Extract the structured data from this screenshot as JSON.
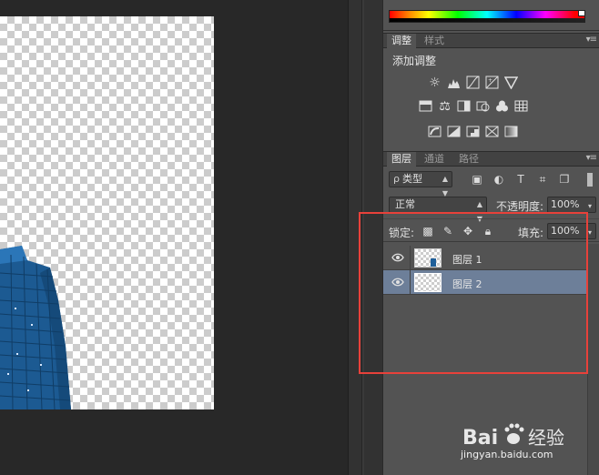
{
  "colors": {
    "accent_highlight": "#e8413a",
    "selected_layer": "#6d7f99",
    "panel_bg": "#535353",
    "canvas_bg": "#282828",
    "building": "#1f5f99"
  },
  "adjustments_panel": {
    "tabs": [
      {
        "label": "调整",
        "active": true
      },
      {
        "label": "样式",
        "active": false
      }
    ],
    "title": "添加调整",
    "icons_row1": [
      "brightness-icon",
      "levels-icon",
      "curves-icon",
      "exposure-icon",
      "vibrance-icon"
    ],
    "icons_row2": [
      "hue-saturation-icon",
      "color-balance-icon",
      "black-white-icon",
      "photo-filter-icon",
      "channel-mixer-icon",
      "color-lookup-icon"
    ],
    "icons_row3": [
      "invert-icon",
      "posterize-icon",
      "threshold-icon",
      "selective-color-icon",
      "gradient-map-icon"
    ]
  },
  "layers_panel": {
    "tabs": [
      {
        "label": "图层",
        "active": true
      },
      {
        "label": "通道",
        "active": false
      },
      {
        "label": "路径",
        "active": false
      }
    ],
    "kind_filter": "类型",
    "kind_filter_lead": "ρ",
    "blend_mode": "正常",
    "opacity_label": "不透明度:",
    "opacity_value": "100%",
    "lock_label": "锁定:",
    "fill_label": "填充:",
    "fill_value": "100%",
    "layers": [
      {
        "name": "图层 1",
        "selected": false,
        "visible": true
      },
      {
        "name": "图层 2",
        "selected": true,
        "visible": true
      }
    ]
  },
  "watermark": {
    "logo_text": "Bai",
    "logo_suffix": "经验",
    "site": "jingyan.baidu.com"
  }
}
